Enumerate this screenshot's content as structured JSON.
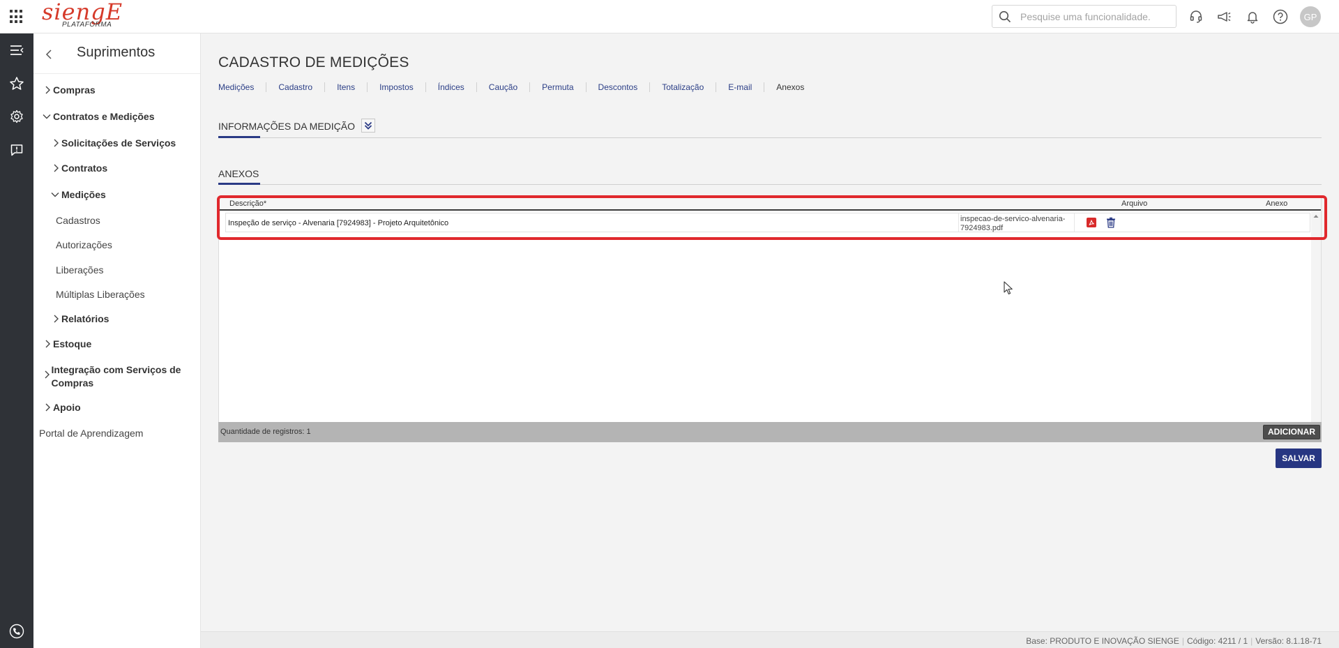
{
  "header": {
    "logo_word": "siengE",
    "logo_sub": "PLATAFORMA",
    "search_placeholder": "Pesquise uma funcionalidade.",
    "avatar_initials": "GP"
  },
  "sidebar": {
    "title": "Suprimentos",
    "items": [
      {
        "label": "Compras"
      },
      {
        "label": "Contratos e Medições"
      },
      {
        "label": "Solicitações de Serviços"
      },
      {
        "label": "Contratos"
      },
      {
        "label": "Medições"
      },
      {
        "label": "Cadastros"
      },
      {
        "label": "Autorizações"
      },
      {
        "label": "Liberações"
      },
      {
        "label": "Múltiplas Liberações"
      },
      {
        "label": "Relatórios"
      },
      {
        "label": "Estoque"
      },
      {
        "label": "Integração com Serviços de Compras"
      },
      {
        "label": "Apoio"
      },
      {
        "label": "Portal de Aprendizagem"
      }
    ]
  },
  "main": {
    "title": "CADASTRO DE MEDIÇÕES",
    "tabs": [
      "Medições",
      "Cadastro",
      "Itens",
      "Impostos",
      "Índices",
      "Caução",
      "Permuta",
      "Descontos",
      "Totalização",
      "E-mail",
      "Anexos"
    ],
    "active_tab": "Anexos",
    "section_info": "INFORMAÇÕES DA MEDIÇÃO",
    "section_attachments": "ANEXOS"
  },
  "grid": {
    "columns": {
      "description": "Descrição*",
      "file": "Arquivo",
      "attachment": "Anexo"
    },
    "rows": [
      {
        "description": "Inspeção de serviço - Alvenaria [7924983] - Projeto Arquitetônico",
        "file": "inspecao-de-servico-alvenaria-7924983.pdf"
      }
    ],
    "record_count": "Quantidade de registros: 1",
    "add_label": "ADICIONAR"
  },
  "actions": {
    "save_label": "SALVAR"
  },
  "footer": {
    "base": "Base: PRODUTO E INOVAÇÃO SIENGE",
    "code": "Código: 4211 / 1",
    "version": "Versão: 8.1.18-71"
  },
  "colors": {
    "brand": "#d63a2a",
    "primary": "#273682",
    "highlight": "#e0282d",
    "rail": "#2f3237"
  }
}
